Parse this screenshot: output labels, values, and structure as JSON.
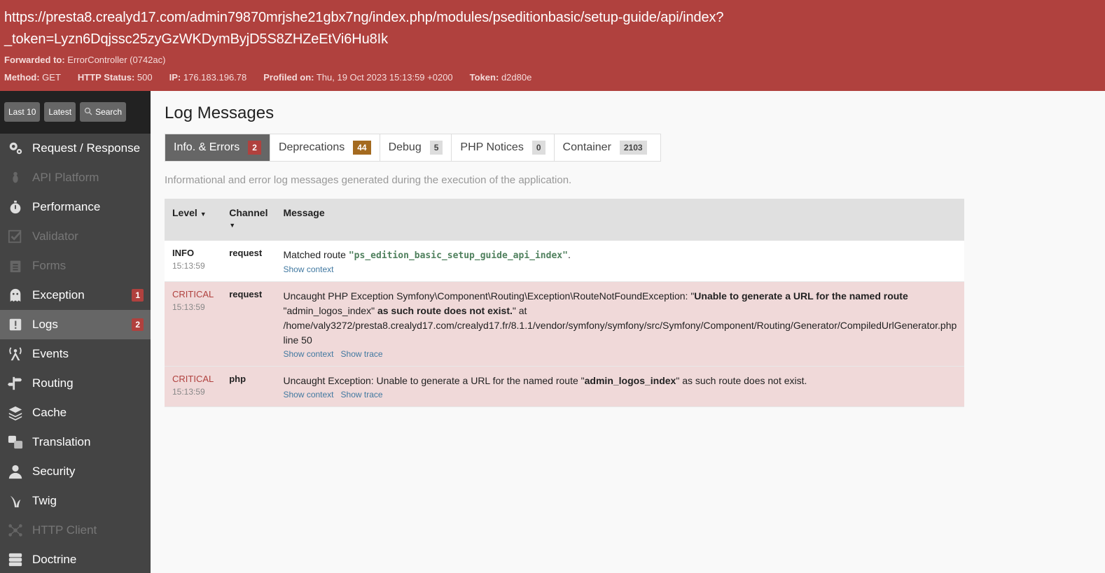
{
  "header": {
    "url": "https://presta8.crealyd17.com/admin79870mrjshe21gbx7ng/index.php/modules/pseditionbasic/setup-guide/api/index?_token=Lyzn6Dqjssc25zyGzWKDymByjD5S8ZHZeEtVi6Hu8Ik",
    "forwarded_label": "Forwarded to:",
    "forwarded_value": "ErrorController (0742ac)",
    "method_label": "Method:",
    "method": "GET",
    "status_label": "HTTP Status:",
    "status": "500",
    "ip_label": "IP:",
    "ip": "176.183.196.78",
    "profiled_label": "Profiled on:",
    "profiled": "Thu, 19 Oct 2023 15:13:59 +0200",
    "token_label": "Token:",
    "token": "d2d80e"
  },
  "search_bar": {
    "last10": "Last 10",
    "latest": "Latest",
    "search": "Search"
  },
  "menu": [
    {
      "label": "Request / Response",
      "icon": "gears-icon"
    },
    {
      "label": "API Platform",
      "icon": "spider-icon"
    },
    {
      "label": "Performance",
      "icon": "stopwatch-icon"
    },
    {
      "label": "Validator",
      "icon": "checkbox-icon"
    },
    {
      "label": "Forms",
      "icon": "clipboard-icon"
    },
    {
      "label": "Exception",
      "icon": "ghost-icon",
      "count": "1"
    },
    {
      "label": "Logs",
      "icon": "alert-icon",
      "count": "2"
    },
    {
      "label": "Events",
      "icon": "antenna-icon"
    },
    {
      "label": "Routing",
      "icon": "signpost-icon"
    },
    {
      "label": "Cache",
      "icon": "layers-icon"
    },
    {
      "label": "Translation",
      "icon": "translate-icon"
    },
    {
      "label": "Security",
      "icon": "user-icon"
    },
    {
      "label": "Twig",
      "icon": "twig-icon"
    },
    {
      "label": "HTTP Client",
      "icon": "network-icon"
    },
    {
      "label": "Doctrine",
      "icon": "database-icon"
    }
  ],
  "main": {
    "title": "Log Messages",
    "tabs": [
      {
        "label": "Info. & Errors",
        "count": "2"
      },
      {
        "label": "Deprecations",
        "count": "44"
      },
      {
        "label": "Debug",
        "count": "5"
      },
      {
        "label": "PHP Notices",
        "count": "0"
      },
      {
        "label": "Container",
        "count": "2103"
      }
    ],
    "description": "Informational and error log messages generated during the execution of the application.",
    "columns": [
      "Level",
      "Channel",
      "Message"
    ],
    "rows": [
      {
        "level": "INFO",
        "time": "15:13:59",
        "channel": "request",
        "msg_pre": "Matched route ",
        "msg_code": "\"ps_edition_basic_setup_guide_api_index\"",
        "msg_post": ".",
        "link1": "Show context"
      },
      {
        "level": "CRITICAL",
        "time": "15:13:59",
        "channel": "request",
        "msg_a": "Uncaught PHP Exception Symfony\\Component\\Routing\\Exception\\RouteNotFoundException: \"",
        "msg_b": "Unable to generate a URL for the named route",
        "msg_c": "\"admin_logos_index\"",
        "msg_d": " as such route does not exist.",
        "msg_e": "\" at /home/valy3272/presta8.crealyd17.com/crealyd17.fr/8.1.1/vendor/symfony/symfony/src/Symfony/Component/Routing/Generator/CompiledUrlGenerator.php line 50",
        "link1": "Show context",
        "link2": "Show trace"
      },
      {
        "level": "CRITICAL",
        "time": "15:13:59",
        "channel": "php",
        "msg_a": "Uncaught Exception: Unable to generate a URL for the named route \"",
        "msg_b": "admin_logos_index",
        "msg_c": "\" as such route does not exist.",
        "link1": "Show context",
        "link2": "Show trace"
      }
    ]
  }
}
